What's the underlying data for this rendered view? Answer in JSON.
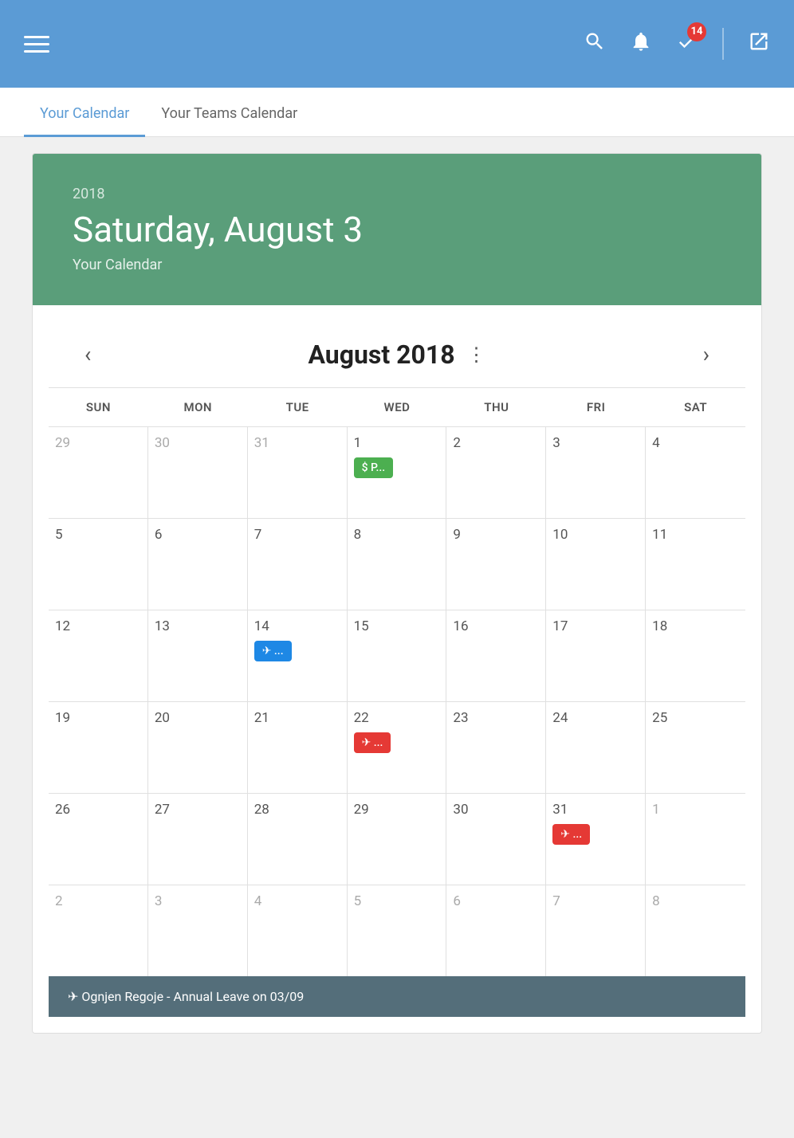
{
  "header": {
    "badge_count": "14",
    "search_label": "search",
    "bell_label": "notifications",
    "check_label": "tasks",
    "external_label": "external-link"
  },
  "tabs": {
    "items": [
      {
        "id": "your-calendar",
        "label": "Your Calendar",
        "active": true
      },
      {
        "id": "teams-calendar",
        "label": "Your Teams Calendar",
        "active": false
      }
    ]
  },
  "calendar_header": {
    "year": "2018",
    "date": "Saturday, August 3",
    "name": "Your Calendar"
  },
  "calendar": {
    "month_title": "August 2018",
    "days_of_week": [
      "SUN",
      "MON",
      "TUE",
      "WED",
      "THU",
      "FRI",
      "SAT"
    ],
    "weeks": [
      [
        {
          "num": "29",
          "current": false,
          "events": []
        },
        {
          "num": "30",
          "current": false,
          "events": []
        },
        {
          "num": "31",
          "current": false,
          "events": []
        },
        {
          "num": "1",
          "current": true,
          "events": [
            {
              "type": "green",
              "icon": "💲",
              "text": "$ P..."
            }
          ]
        },
        {
          "num": "2",
          "current": true,
          "events": []
        },
        {
          "num": "3",
          "current": true,
          "events": []
        },
        {
          "num": "4",
          "current": true,
          "events": []
        }
      ],
      [
        {
          "num": "5",
          "current": true,
          "events": []
        },
        {
          "num": "6",
          "current": true,
          "events": []
        },
        {
          "num": "7",
          "current": true,
          "events": []
        },
        {
          "num": "8",
          "current": true,
          "events": []
        },
        {
          "num": "9",
          "current": true,
          "events": []
        },
        {
          "num": "10",
          "current": true,
          "events": []
        },
        {
          "num": "11",
          "current": true,
          "events": []
        }
      ],
      [
        {
          "num": "12",
          "current": true,
          "events": []
        },
        {
          "num": "13",
          "current": true,
          "events": []
        },
        {
          "num": "14",
          "current": true,
          "events": [
            {
              "type": "blue",
              "icon": "✈",
              "text": "✈ ..."
            }
          ]
        },
        {
          "num": "15",
          "current": true,
          "events": []
        },
        {
          "num": "16",
          "current": true,
          "events": []
        },
        {
          "num": "17",
          "current": true,
          "events": []
        },
        {
          "num": "18",
          "current": true,
          "events": []
        }
      ],
      [
        {
          "num": "19",
          "current": true,
          "events": []
        },
        {
          "num": "20",
          "current": true,
          "events": []
        },
        {
          "num": "21",
          "current": true,
          "events": []
        },
        {
          "num": "22",
          "current": true,
          "events": [
            {
              "type": "red",
              "icon": "✈",
              "text": "✈ ..."
            }
          ]
        },
        {
          "num": "23",
          "current": true,
          "events": []
        },
        {
          "num": "24",
          "current": true,
          "events": []
        },
        {
          "num": "25",
          "current": true,
          "events": []
        }
      ],
      [
        {
          "num": "26",
          "current": true,
          "events": []
        },
        {
          "num": "27",
          "current": true,
          "events": []
        },
        {
          "num": "28",
          "current": true,
          "events": []
        },
        {
          "num": "29",
          "current": true,
          "events": []
        },
        {
          "num": "30",
          "current": true,
          "events": []
        },
        {
          "num": "31",
          "current": true,
          "events": [
            {
              "type": "red",
              "icon": "✈",
              "text": "✈ ..."
            }
          ]
        },
        {
          "num": "1",
          "current": false,
          "events": []
        }
      ],
      [
        {
          "num": "2",
          "current": false,
          "events": []
        },
        {
          "num": "3",
          "current": false,
          "events": []
        },
        {
          "num": "4",
          "current": false,
          "events": []
        },
        {
          "num": "5",
          "current": false,
          "events": []
        },
        {
          "num": "6",
          "current": false,
          "events": []
        },
        {
          "num": "7",
          "current": false,
          "events": []
        },
        {
          "num": "8",
          "current": false,
          "events": []
        }
      ]
    ],
    "tooltip": "✈ Ognjen Regoje - Annual Leave on 03/09"
  }
}
